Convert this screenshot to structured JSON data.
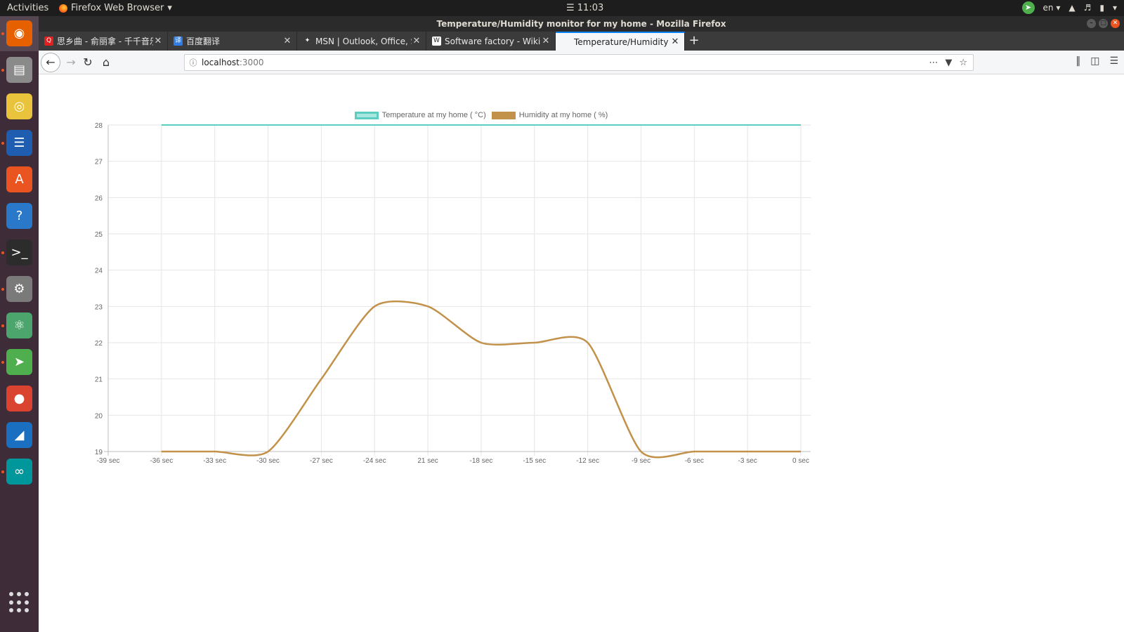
{
  "topbar": {
    "activities": "Activities",
    "app_name": "Firefox Web Browser",
    "clock": "☰ 11:03",
    "language": "en"
  },
  "window": {
    "title": "Temperature/Humidity monitor for my home - Mozilla Firefox"
  },
  "tabs": [
    {
      "label": "思乡曲 - 俞丽拿 - 千千音乐",
      "favicon_color": "#e02020",
      "favicon_glyph": "Q",
      "active": false
    },
    {
      "label": "百度翻译",
      "favicon_color": "#2f7ce6",
      "favicon_glyph": "译",
      "active": false
    },
    {
      "label": "MSN | Outlook, Office, Skype",
      "favicon_color": "#3b3b3b",
      "favicon_glyph": "✦",
      "active": false
    },
    {
      "label": "Software factory - Wikipedia",
      "favicon_color": "#ffffff",
      "favicon_glyph": "W",
      "active": false
    },
    {
      "label": "Temperature/Humidity monitor",
      "favicon_color": "#f5f6f7",
      "favicon_glyph": "",
      "active": true
    }
  ],
  "navbar": {
    "url_host": "localhost",
    "url_port": ":3000"
  },
  "dock": {
    "items": [
      {
        "name": "firefox-icon",
        "color": "#e66000",
        "glyph": "◉"
      },
      {
        "name": "files-icon",
        "color": "#8a8a8a",
        "glyph": "▤"
      },
      {
        "name": "rhythmbox-icon",
        "color": "#e8c33b",
        "glyph": "◎"
      },
      {
        "name": "writer-icon",
        "color": "#1f5db0",
        "glyph": "☰"
      },
      {
        "name": "software-center-icon",
        "color": "#e95420",
        "glyph": "A"
      },
      {
        "name": "help-icon",
        "color": "#2a78c9",
        "glyph": "?"
      },
      {
        "name": "terminal-icon",
        "color": "#2c2c2c",
        "glyph": ">_"
      },
      {
        "name": "settings-icon",
        "color": "#7a7a7a",
        "glyph": "⚙"
      },
      {
        "name": "atom-icon",
        "color": "#4ca56d",
        "glyph": "⚛"
      },
      {
        "name": "telegram-icon",
        "color": "#4fae4e",
        "glyph": "➤"
      },
      {
        "name": "chrome-icon",
        "color": "#d9432f",
        "glyph": "●"
      },
      {
        "name": "wireshark-icon",
        "color": "#1a6fc0",
        "glyph": "◢"
      },
      {
        "name": "arduino-icon",
        "color": "#00979c",
        "glyph": "∞"
      }
    ]
  },
  "chart_data": {
    "type": "line",
    "categories": [
      "-39 sec",
      "-36 sec",
      "-33 sec",
      "-30 sec",
      "-27 sec",
      "-24 sec",
      "21 sec",
      "-18 sec",
      "-15 sec",
      "-12 sec",
      "-9 sec",
      "-6 sec",
      "-3 sec",
      "0 sec"
    ],
    "series": [
      {
        "name": "Temperature at my home ( °C)",
        "color": "#5ccdc1",
        "fill": "#a8e6e0",
        "values": [
          null,
          28,
          28,
          28,
          28,
          28,
          28,
          28,
          28,
          28,
          28,
          28,
          28,
          28
        ]
      },
      {
        "name": "Humidity at my home ( %)",
        "color": "#c2914a",
        "fill": "#c2914a",
        "values": [
          null,
          19,
          19,
          19,
          21,
          23,
          23,
          22,
          22,
          22,
          19,
          19,
          19,
          19
        ]
      }
    ],
    "yticks": [
      "19",
      "20",
      "21",
      "22",
      "23",
      "24",
      "25",
      "26",
      "27",
      "28"
    ],
    "ylim": [
      19,
      28
    ],
    "grid": true,
    "legend_position": "top"
  }
}
